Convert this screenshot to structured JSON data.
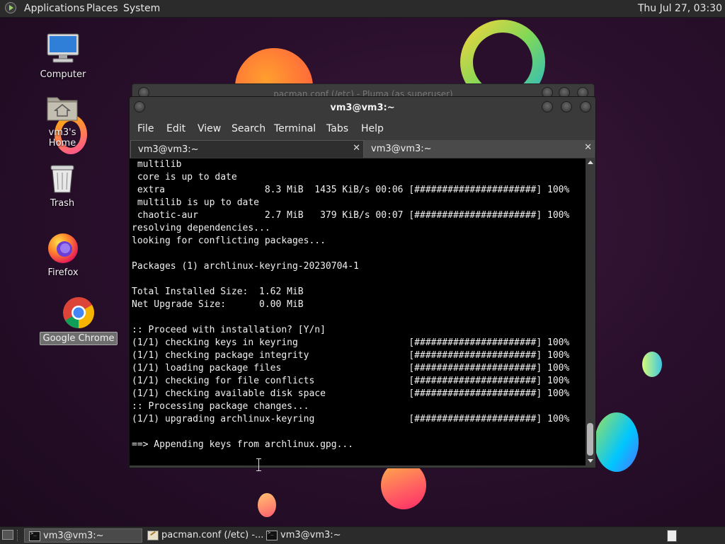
{
  "top_panel": {
    "menu_applications": "Applications",
    "menu_places": "Places",
    "menu_system": "System",
    "clock": "Thu Jul 27, 03:30"
  },
  "desktop": {
    "icons": [
      {
        "label": "Computer",
        "icon": "computer-icon"
      },
      {
        "label": "vm3's Home",
        "icon": "home-folder-icon"
      },
      {
        "label": "Trash",
        "icon": "trash-icon"
      },
      {
        "label": "Firefox",
        "icon": "firefox-icon"
      },
      {
        "label": "Google Chrome",
        "icon": "chrome-icon"
      }
    ]
  },
  "pluma_window": {
    "title": "pacman.conf (/etc) - Pluma (as superuser)"
  },
  "terminal": {
    "title": "vm3@vm3:~",
    "menu": [
      "File",
      "Edit",
      "View",
      "Search",
      "Terminal",
      "Tabs",
      "Help"
    ],
    "tabs": [
      {
        "label": "vm3@vm3:~",
        "active": true
      },
      {
        "label": "vm3@vm3:~",
        "active": false
      }
    ],
    "lines": [
      " multilib",
      " core is up to date",
      " extra                  8.3 MiB  1435 KiB/s 00:06 [######################] 100%",
      " multilib is up to date",
      " chaotic-aur            2.7 MiB   379 KiB/s 00:07 [######################] 100%",
      "resolving dependencies...",
      "looking for conflicting packages...",
      "",
      "Packages (1) archlinux-keyring-20230704-1",
      "",
      "Total Installed Size:  1.62 MiB",
      "Net Upgrade Size:      0.00 MiB",
      "",
      ":: Proceed with installation? [Y/n]",
      "(1/1) checking keys in keyring                    [######################] 100%",
      "(1/1) checking package integrity                  [######################] 100%",
      "(1/1) loading package files                       [######################] 100%",
      "(1/1) checking for file conflicts                 [######################] 100%",
      "(1/1) checking available disk space               [######################] 100%",
      ":: Processing package changes...",
      "(1/1) upgrading archlinux-keyring                 [######################] 100%",
      "",
      "==> Appending keys from archlinux.gpg...",
      ""
    ]
  },
  "taskbar": {
    "items": [
      {
        "label": "vm3@vm3:~",
        "icon": "terminal-icon",
        "active": true
      },
      {
        "label": "pacman.conf (/etc) -...",
        "icon": "text-editor-icon",
        "active": false
      },
      {
        "label": "vm3@vm3:~",
        "icon": "terminal-icon",
        "active": false
      }
    ]
  },
  "colors": {
    "desktop_bg": "#2a0f2c",
    "panel_bg": "#2b2b2b",
    "terminal_bg": "#000000",
    "terminal_fg": "#f0f0f0"
  }
}
